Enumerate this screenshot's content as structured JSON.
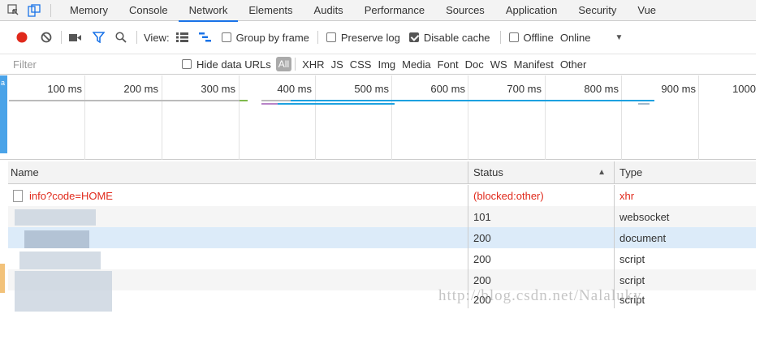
{
  "tabs": [
    "Memory",
    "Console",
    "Network",
    "Elements",
    "Audits",
    "Performance",
    "Sources",
    "Application",
    "Security",
    "Vue"
  ],
  "active_tab": "Network",
  "toolbar": {
    "view_label": "View:",
    "group_by_frame": "Group by frame",
    "preserve_log": "Preserve log",
    "disable_cache": "Disable cache",
    "offline": "Offline",
    "throttle": "Online"
  },
  "filter": {
    "placeholder": "Filter",
    "hide_data_urls": "Hide data URLs",
    "all": "All",
    "types": [
      "XHR",
      "JS",
      "CSS",
      "Img",
      "Media",
      "Font",
      "Doc",
      "WS",
      "Manifest",
      "Other"
    ]
  },
  "overview": {
    "ticks": [
      "100 ms",
      "200 ms",
      "300 ms",
      "400 ms",
      "500 ms",
      "600 ms",
      "700 ms",
      "800 ms",
      "900 ms",
      "1000"
    ]
  },
  "table": {
    "headers": {
      "name": "Name",
      "status": "Status",
      "type": "Type"
    },
    "rows": [
      {
        "name": "info?code=HOME",
        "status": "(blocked:other)",
        "type": "xhr"
      },
      {
        "name": "",
        "status": "101",
        "type": "websocket"
      },
      {
        "name": "",
        "status": "200",
        "type": "document"
      },
      {
        "name": "",
        "status": "200",
        "type": "script"
      },
      {
        "name": "",
        "status": "200",
        "type": "script"
      },
      {
        "name": "",
        "status": "200",
        "type": "script"
      }
    ]
  },
  "watermark": "http://blog.csdn.net/Nalaluky",
  "colors": {
    "accent": "#1a73e8",
    "record": "#e0291b",
    "filter": "#1a73e8",
    "error": "#e0291b",
    "selected_row": "#dcebf9"
  }
}
